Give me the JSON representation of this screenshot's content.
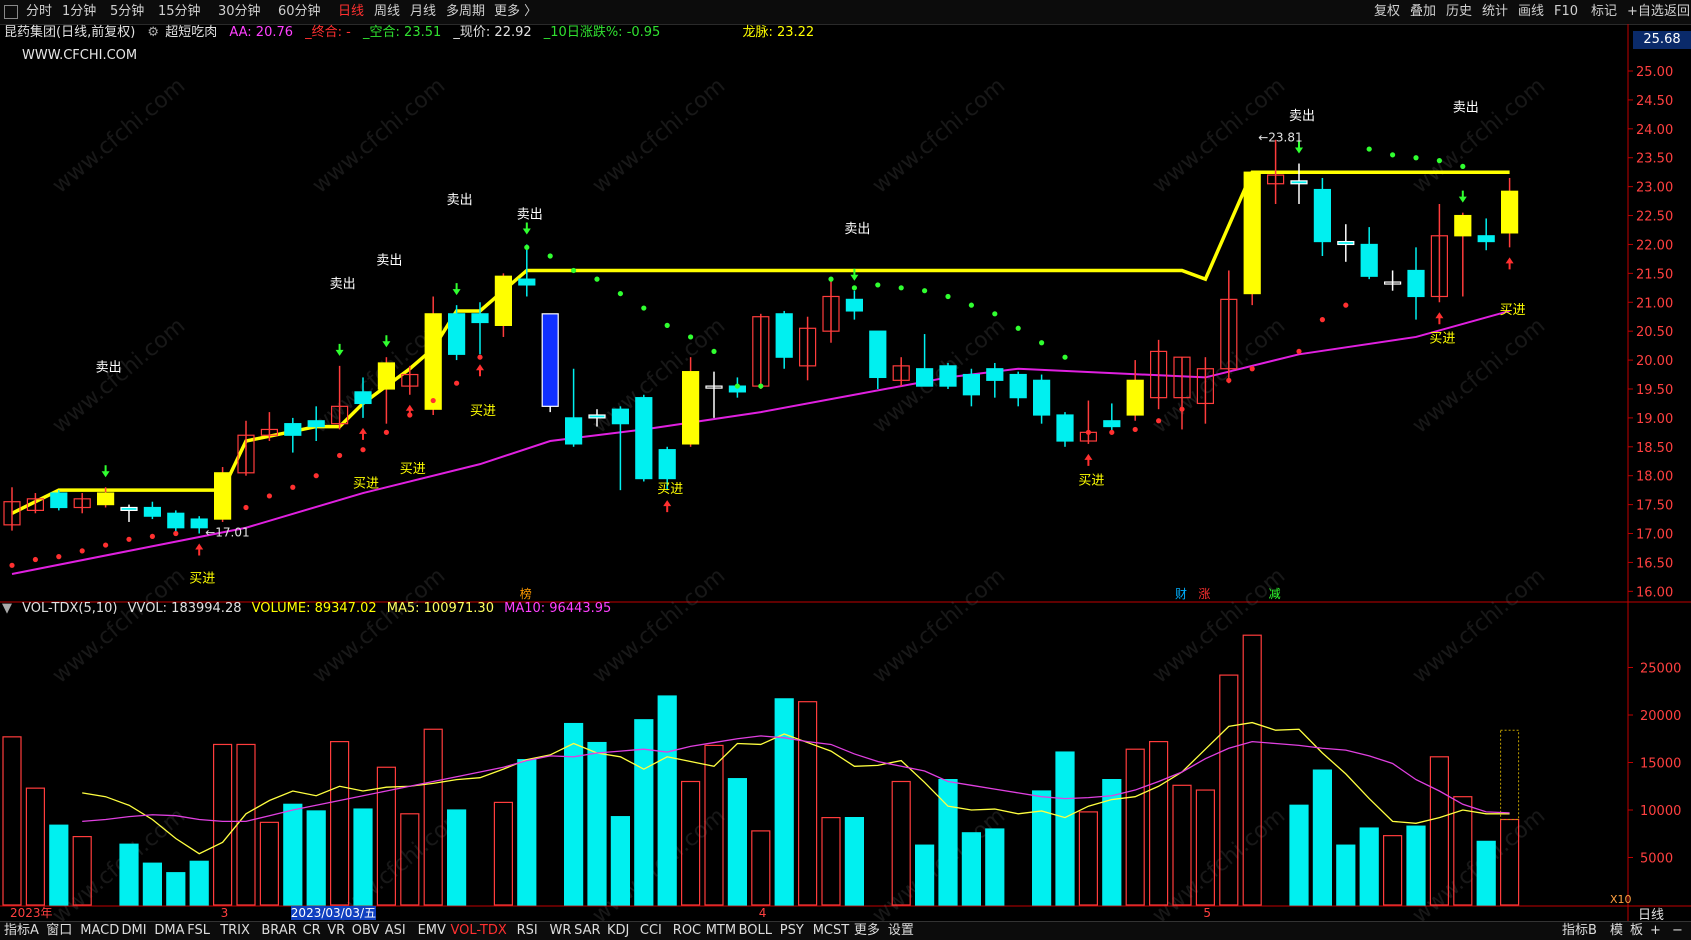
{
  "toolbar": {
    "left_items": [
      "分时",
      "1分钟",
      "5分钟",
      "15分钟",
      "30分钟",
      "60分钟",
      "日线",
      "周线",
      "月线",
      "多周期",
      "更多 〉"
    ],
    "active_item": "日线",
    "right_items": [
      "复权",
      "叠加",
      "历史",
      "统计",
      "画线",
      "F10",
      "标记",
      "+自选",
      "返回"
    ]
  },
  "info": {
    "stock": "昆药集团(日线,前复权)",
    "indicator": "超短吃肉",
    "aa": "AA: 20.76",
    "zhongge": "_终合: -",
    "kongge": "_空合: 23.51",
    "price": "_现价: 22.92",
    "pct10": "_10日涨跌%: -0.95",
    "longmai": "龙脉: 23.22",
    "website": "WWW.CFCHI.COM",
    "watermark": "www.cfchi.com"
  },
  "colors": {
    "up": "#ff3c3c",
    "down": "#00f0f0",
    "yellow_line": "#ffff00",
    "ma_line": "#e020e0",
    "buy_text": "#ffff00",
    "sell_text": "#ffffff",
    "axis": "#c00000"
  },
  "vol_info": {
    "name": "VOL-TDX(5,10)",
    "vvol": "VVOL: 183994.28",
    "volume": "VOLUME: 89347.02",
    "ma5": "MA5: 100971.30",
    "ma10": "MA10: 96443.95"
  },
  "right_axis_badge": "25.68",
  "right_axis_footer": "日线",
  "vol_scale_label": "X10",
  "date_labels": [
    {
      "text": "2023年",
      "index": 0
    },
    {
      "text": "3",
      "index": 9
    },
    {
      "text": "2023/03/03/五",
      "index": 12
    },
    {
      "text": "4",
      "index": 32
    },
    {
      "text": "5",
      "index": 51
    }
  ],
  "event_marks": [
    {
      "text": "榜",
      "index": 22,
      "color": "#ff9a00"
    },
    {
      "text": "财",
      "index": 50,
      "color": "#00b0ff"
    },
    {
      "text": "涨",
      "index": 51,
      "color": "#ff3030"
    },
    {
      "text": "减",
      "index": 54,
      "color": "#30ff30"
    }
  ],
  "bottom_tabs": [
    "指标A",
    "窗口",
    "MACD",
    "DMI",
    "DMA",
    "FSL",
    "TRIX",
    "BRAR",
    "CR",
    "VR",
    "OBV",
    "ASI",
    "EMV",
    "VOL-TDX",
    "RSI",
    "WR",
    "SAR",
    "KDJ",
    "CCI",
    "ROC",
    "MTM",
    "BOLL",
    "PSY",
    "MCST",
    "更多",
    "设置"
  ],
  "bottom_active": "VOL-TDX",
  "bottom_right": [
    "指标B",
    "模",
    "板",
    "+",
    "−"
  ],
  "chart_data": {
    "type": "candlestick",
    "price_axis": {
      "ylim": [
        15.85,
        25.45
      ],
      "ticks": [
        16.0,
        16.5,
        17.0,
        17.5,
        18.0,
        18.5,
        19.0,
        19.5,
        20.0,
        20.5,
        21.0,
        21.5,
        22.0,
        22.5,
        23.0,
        23.5,
        24.0,
        24.5,
        25.0
      ]
    },
    "volume_axis": {
      "ylim": [
        0,
        30000
      ],
      "ticks": [
        5000,
        10000,
        15000,
        20000,
        25000
      ]
    },
    "candles": [
      {
        "o": 17.15,
        "h": 17.8,
        "l": 17.05,
        "c": 17.55,
        "v": 17700,
        "yc": false
      },
      {
        "o": 17.4,
        "h": 17.7,
        "l": 17.35,
        "c": 17.6,
        "v": 12300,
        "yc": false
      },
      {
        "o": 17.7,
        "h": 17.75,
        "l": 17.4,
        "c": 17.45,
        "v": 8400,
        "yc": false
      },
      {
        "o": 17.45,
        "h": 17.7,
        "l": 17.35,
        "c": 17.6,
        "v": 7200,
        "yc": false
      },
      {
        "o": 17.7,
        "h": 17.8,
        "l": 17.45,
        "c": 17.5,
        "v": 0,
        "yc": true
      },
      {
        "o": 17.45,
        "h": 17.5,
        "l": 17.2,
        "c": 17.4,
        "v": 6400,
        "yc": false
      },
      {
        "o": 17.45,
        "h": 17.55,
        "l": 17.25,
        "c": 17.3,
        "v": 4400,
        "yc": false
      },
      {
        "o": 17.35,
        "h": 17.4,
        "l": 17.0,
        "c": 17.1,
        "v": 3400,
        "yc": false
      },
      {
        "o": 17.25,
        "h": 17.3,
        "l": 17.0,
        "c": 17.1,
        "v": 4600,
        "yc": false
      },
      {
        "o": 17.25,
        "h": 18.15,
        "l": 17.2,
        "c": 18.05,
        "v": 16900,
        "yc": true
      },
      {
        "o": 18.05,
        "h": 18.95,
        "l": 18.0,
        "c": 18.7,
        "v": 16900,
        "yc": false
      },
      {
        "o": 18.7,
        "h": 19.1,
        "l": 18.6,
        "c": 18.8,
        "v": 8700,
        "yc": false
      },
      {
        "o": 18.9,
        "h": 19.0,
        "l": 18.4,
        "c": 18.7,
        "v": 10600,
        "yc": false
      },
      {
        "o": 18.95,
        "h": 19.2,
        "l": 18.6,
        "c": 18.85,
        "v": 9900,
        "yc": false
      },
      {
        "o": 18.9,
        "h": 19.9,
        "l": 18.8,
        "c": 19.2,
        "v": 17200,
        "yc": false
      },
      {
        "o": 19.45,
        "h": 19.7,
        "l": 19.0,
        "c": 19.25,
        "v": 10100,
        "yc": false
      },
      {
        "o": 19.5,
        "h": 20.05,
        "l": 18.9,
        "c": 19.95,
        "v": 14500,
        "yc": true
      },
      {
        "o": 19.55,
        "h": 19.9,
        "l": 19.4,
        "c": 19.75,
        "v": 9600,
        "yc": false
      },
      {
        "o": 19.15,
        "h": 21.1,
        "l": 19.05,
        "c": 20.8,
        "v": 18500,
        "yc": true
      },
      {
        "o": 20.8,
        "h": 20.95,
        "l": 20.0,
        "c": 20.1,
        "v": 10000,
        "yc": false
      },
      {
        "o": 20.8,
        "h": 21.0,
        "l": 20.1,
        "c": 20.65,
        "v": 0,
        "yc": false
      },
      {
        "o": 20.6,
        "h": 21.5,
        "l": 20.4,
        "c": 21.45,
        "v": 10800,
        "yc": true
      },
      {
        "o": 21.4,
        "h": 22.0,
        "l": 21.1,
        "c": 21.3,
        "v": 15300,
        "yc": false
      },
      {
        "o": 19.2,
        "h": 20.8,
        "l": 19.1,
        "c": 20.8,
        "v": 0,
        "yc": false,
        "blue": true
      },
      {
        "o": 19.0,
        "h": 19.85,
        "l": 18.5,
        "c": 18.55,
        "v": 19100,
        "yc": false
      },
      {
        "o": 19.05,
        "h": 19.15,
        "l": 18.85,
        "c": 19.0,
        "v": 17100,
        "yc": false
      },
      {
        "o": 19.15,
        "h": 19.2,
        "l": 17.75,
        "c": 18.9,
        "v": 9300,
        "yc": false
      },
      {
        "o": 19.35,
        "h": 19.4,
        "l": 17.9,
        "c": 17.95,
        "v": 19500,
        "yc": false
      },
      {
        "o": 18.45,
        "h": 18.5,
        "l": 17.75,
        "c": 17.95,
        "v": 22000,
        "yc": false
      },
      {
        "o": 18.55,
        "h": 20.05,
        "l": 18.5,
        "c": 19.8,
        "v": 13000,
        "yc": true
      },
      {
        "o": 19.55,
        "h": 19.8,
        "l": 19.0,
        "c": 19.55,
        "v": 16800,
        "yc": false
      },
      {
        "o": 19.55,
        "h": 19.7,
        "l": 19.35,
        "c": 19.45,
        "v": 13300,
        "yc": false
      },
      {
        "o": 19.55,
        "h": 20.8,
        "l": 19.5,
        "c": 20.75,
        "v": 7800,
        "yc": false
      },
      {
        "o": 20.8,
        "h": 20.85,
        "l": 19.85,
        "c": 20.05,
        "v": 21700,
        "yc": false
      },
      {
        "o": 19.9,
        "h": 20.75,
        "l": 19.65,
        "c": 20.55,
        "v": 21400,
        "yc": false
      },
      {
        "o": 20.5,
        "h": 21.4,
        "l": 20.3,
        "c": 21.1,
        "v": 9200,
        "yc": false
      },
      {
        "o": 21.05,
        "h": 21.2,
        "l": 20.7,
        "c": 20.85,
        "v": 9200,
        "yc": false
      },
      {
        "o": 20.5,
        "h": 20.5,
        "l": 19.5,
        "c": 19.7,
        "v": 0,
        "yc": false
      },
      {
        "o": 19.65,
        "h": 20.05,
        "l": 19.55,
        "c": 19.9,
        "v": 13000,
        "yc": false
      },
      {
        "o": 19.85,
        "h": 20.45,
        "l": 19.55,
        "c": 19.55,
        "v": 6300,
        "yc": false
      },
      {
        "o": 19.9,
        "h": 19.95,
        "l": 19.5,
        "c": 19.55,
        "v": 13200,
        "yc": false
      },
      {
        "o": 19.75,
        "h": 19.85,
        "l": 19.2,
        "c": 19.4,
        "v": 7600,
        "yc": false
      },
      {
        "o": 19.85,
        "h": 19.95,
        "l": 19.35,
        "c": 19.65,
        "v": 8000,
        "yc": false
      },
      {
        "o": 19.75,
        "h": 19.8,
        "l": 19.2,
        "c": 19.35,
        "v": 0,
        "yc": false
      },
      {
        "o": 19.65,
        "h": 19.75,
        "l": 18.9,
        "c": 19.05,
        "v": 12000,
        "yc": false
      },
      {
        "o": 19.05,
        "h": 19.1,
        "l": 18.5,
        "c": 18.6,
        "v": 16100,
        "yc": false
      },
      {
        "o": 18.6,
        "h": 19.3,
        "l": 18.55,
        "c": 18.75,
        "v": 9800,
        "yc": false
      },
      {
        "o": 18.95,
        "h": 19.25,
        "l": 18.75,
        "c": 18.85,
        "v": 13200,
        "yc": false
      },
      {
        "o": 19.05,
        "h": 20.0,
        "l": 18.95,
        "c": 19.65,
        "v": 16400,
        "yc": true
      },
      {
        "o": 19.35,
        "h": 20.35,
        "l": 19.15,
        "c": 20.15,
        "v": 17200,
        "yc": false
      },
      {
        "o": 19.35,
        "h": 20.05,
        "l": 18.8,
        "c": 20.05,
        "v": 12600,
        "yc": false
      },
      {
        "o": 19.25,
        "h": 20.05,
        "l": 18.9,
        "c": 19.85,
        "v": 12100,
        "yc": false
      },
      {
        "o": 19.85,
        "h": 21.55,
        "l": 19.6,
        "c": 21.05,
        "v": 24200,
        "yc": false
      },
      {
        "o": 21.15,
        "h": 23.25,
        "l": 20.95,
        "c": 23.25,
        "v": 28400,
        "yc": true
      },
      {
        "o": 23.05,
        "h": 23.81,
        "l": 22.7,
        "c": 23.2,
        "v": 0,
        "yc": false
      },
      {
        "o": 23.1,
        "h": 23.4,
        "l": 22.7,
        "c": 23.05,
        "v": 10500,
        "yc": false
      },
      {
        "o": 22.95,
        "h": 23.15,
        "l": 21.8,
        "c": 22.05,
        "v": 14200,
        "yc": false
      },
      {
        "o": 22.05,
        "h": 22.35,
        "l": 21.7,
        "c": 22.0,
        "v": 6300,
        "yc": false
      },
      {
        "o": 22.0,
        "h": 22.3,
        "l": 21.4,
        "c": 21.45,
        "v": 8100,
        "yc": false
      },
      {
        "o": 21.35,
        "h": 21.55,
        "l": 21.2,
        "c": 21.35,
        "v": 7300,
        "yc": false
      },
      {
        "o": 21.55,
        "h": 21.95,
        "l": 20.7,
        "c": 21.1,
        "v": 8300,
        "yc": false
      },
      {
        "o": 21.1,
        "h": 22.7,
        "l": 21.0,
        "c": 22.15,
        "v": 15600,
        "yc": false
      },
      {
        "o": 22.15,
        "h": 22.55,
        "l": 21.1,
        "c": 22.5,
        "v": 11400,
        "yc": true
      },
      {
        "o": 22.15,
        "h": 22.45,
        "l": 21.9,
        "c": 22.05,
        "v": 6700,
        "yc": false
      },
      {
        "o": 22.2,
        "h": 23.15,
        "l": 21.95,
        "c": 22.92,
        "v": 9000,
        "yc": true
      }
    ],
    "yellow_line": [
      [
        0,
        17.35
      ],
      [
        2,
        17.75
      ],
      [
        8,
        17.75
      ],
      [
        9,
        17.75
      ],
      [
        10,
        18.6
      ],
      [
        13,
        18.85
      ],
      [
        14,
        18.85
      ],
      [
        15,
        19.25
      ],
      [
        17,
        19.85
      ],
      [
        18,
        20.2
      ],
      [
        19,
        20.85
      ],
      [
        20,
        20.85
      ],
      [
        22,
        21.55
      ],
      [
        50,
        21.55
      ],
      [
        51,
        21.4
      ],
      [
        53,
        23.25
      ],
      [
        64,
        23.25
      ]
    ],
    "ma_line": [
      [
        0,
        16.3
      ],
      [
        5,
        16.7
      ],
      [
        10,
        17.1
      ],
      [
        15,
        17.7
      ],
      [
        20,
        18.2
      ],
      [
        23,
        18.6
      ],
      [
        27,
        18.8
      ],
      [
        32,
        19.1
      ],
      [
        36,
        19.4
      ],
      [
        40,
        19.7
      ],
      [
        43,
        19.85
      ],
      [
        51,
        19.7
      ],
      [
        55,
        20.1
      ],
      [
        60,
        20.4
      ],
      [
        64,
        20.85
      ]
    ],
    "sar_points": [
      [
        0,
        16.45
      ],
      [
        1,
        16.55
      ],
      [
        2,
        16.6
      ],
      [
        3,
        16.7
      ],
      [
        4,
        16.8
      ],
      [
        5,
        16.9
      ],
      [
        6,
        16.95
      ],
      [
        7,
        17.0
      ],
      [
        10,
        17.45
      ],
      [
        11,
        17.65
      ],
      [
        12,
        17.8
      ],
      [
        13,
        18.0
      ],
      [
        14,
        18.35
      ],
      [
        15,
        18.45
      ],
      [
        16,
        18.75
      ],
      [
        17,
        19.05
      ],
      [
        18,
        19.3
      ],
      [
        19,
        19.6
      ],
      [
        20,
        20.05
      ],
      [
        22,
        21.95
      ],
      [
        23,
        21.8
      ],
      [
        24,
        21.55
      ],
      [
        25,
        21.4
      ],
      [
        26,
        21.15
      ],
      [
        27,
        20.9
      ],
      [
        28,
        20.6
      ],
      [
        29,
        20.4
      ],
      [
        30,
        20.15
      ],
      [
        31,
        19.55
      ],
      [
        32,
        19.55
      ],
      [
        35,
        21.4
      ],
      [
        36,
        21.25
      ],
      [
        37,
        21.3
      ],
      [
        38,
        21.25
      ],
      [
        39,
        21.2
      ],
      [
        40,
        21.1
      ],
      [
        41,
        20.95
      ],
      [
        42,
        20.8
      ],
      [
        43,
        20.55
      ],
      [
        44,
        20.3
      ],
      [
        45,
        20.05
      ],
      [
        46,
        18.75
      ],
      [
        47,
        18.75
      ],
      [
        48,
        18.8
      ],
      [
        49,
        18.95
      ],
      [
        50,
        19.15
      ],
      [
        52,
        19.65
      ],
      [
        53,
        19.85
      ],
      [
        55,
        20.15
      ],
      [
        56,
        20.7
      ],
      [
        57,
        20.95
      ],
      [
        58,
        23.65
      ],
      [
        59,
        23.55
      ],
      [
        60,
        23.5
      ],
      [
        61,
        23.45
      ],
      [
        62,
        23.35
      ]
    ],
    "buy_signals": [
      8,
      15,
      17,
      20,
      28,
      46,
      61,
      64
    ],
    "sell_signals": [
      4,
      14,
      16,
      19,
      22,
      36,
      55,
      62
    ],
    "labels": [
      {
        "text": "卖出",
        "index": 4,
        "y": 19.8,
        "kind": "sell"
      },
      {
        "text": "卖出",
        "index": 14,
        "y": 21.25,
        "kind": "sell"
      },
      {
        "text": "卖出",
        "index": 16,
        "y": 21.65,
        "kind": "sell"
      },
      {
        "text": "卖出",
        "index": 19,
        "y": 22.7,
        "kind": "sell"
      },
      {
        "text": "卖出",
        "index": 22,
        "y": 22.45,
        "kind": "sell"
      },
      {
        "text": "卖出",
        "index": 36,
        "y": 22.2,
        "kind": "sell"
      },
      {
        "text": "卖出",
        "index": 55,
        "y": 24.15,
        "kind": "sell"
      },
      {
        "text": "卖出",
        "index": 62,
        "y": 24.3,
        "kind": "sell"
      },
      {
        "text": "买进",
        "index": 8,
        "y": 16.15,
        "kind": "buy"
      },
      {
        "text": "买进",
        "index": 15,
        "y": 17.8,
        "kind": "buy"
      },
      {
        "text": "买进",
        "index": 17,
        "y": 18.05,
        "kind": "buy"
      },
      {
        "text": "买进",
        "index": 20,
        "y": 19.05,
        "kind": "buy"
      },
      {
        "text": "买进",
        "index": 28,
        "y": 17.7,
        "kind": "buy"
      },
      {
        "text": "买进",
        "index": 46,
        "y": 17.85,
        "kind": "buy"
      },
      {
        "text": "买进",
        "index": 61,
        "y": 20.3,
        "kind": "buy"
      },
      {
        "text": "买进",
        "index": 64,
        "y": 20.8,
        "kind": "buy"
      }
    ],
    "annotations": [
      {
        "text": "←17.01",
        "index": 8,
        "y": 17.02
      },
      {
        "text": "←23.81",
        "index": 53,
        "y": 23.85
      }
    ],
    "vol_ma5": [
      11800,
      11400,
      10500,
      9000,
      7000,
      5400,
      6600,
      9600,
      11000,
      12000,
      11500,
      12500,
      12000,
      12400,
      12500,
      12800,
      13200,
      13400,
      14300,
      15300,
      15800,
      17000,
      16000,
      15600,
      14300,
      15600,
      15100,
      14600,
      17000,
      16900,
      18000,
      17100,
      16200,
      14600,
      14700,
      15200,
      12900,
      10400,
      10000,
      10100,
      9600,
      9900,
      9200,
      10400,
      11100,
      11400,
      12500,
      14000,
      16400,
      18800,
      19200,
      18400,
      18500,
      16000,
      13800,
      11200,
      8800,
      8600,
      9200,
      10000,
      9600,
      9600
    ],
    "vol_ma10": [
      8800,
      9000,
      9300,
      9500,
      9400,
      9000,
      8800,
      8800,
      9400,
      10000,
      10500,
      11000,
      11500,
      12000,
      12500,
      13000,
      13500,
      14000,
      14500,
      15200,
      15700,
      15600,
      16000,
      16200,
      16400,
      16100,
      16700,
      17100,
      17500,
      17800,
      17600,
      17200,
      16900,
      15900,
      15100,
      14600,
      14100,
      13000,
      12600,
      12200,
      11800,
      11400,
      11200,
      11300,
      11500,
      12100,
      13000,
      14000,
      15400,
      16500,
      17200,
      17000,
      16800,
      16500,
      16300,
      15700,
      14900,
      13200,
      12000,
      10600,
      9800,
      9700
    ]
  }
}
